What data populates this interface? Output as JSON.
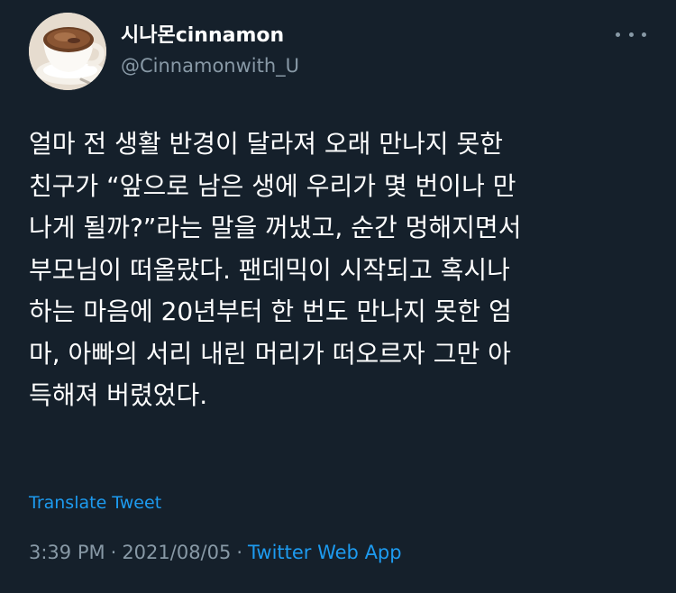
{
  "user": {
    "display_name": "시나몬cinnamon",
    "handle": "@Cinnamonwith_U"
  },
  "tweet": {
    "lines": [
      "얼마 전 생활 반경이 달라져 오래 만나지 못한",
      "친구가 “앞으로 남은 생에 우리가 몇 번이나 만",
      "나게 될까?”라는 말을 꺼냈고, 순간 멍해지면서",
      "부모님이 떠올랐다. 팬데믹이 시작되고 혹시나",
      "하는 마음에 20년부터 한 번도 만나지 못한 엄",
      "마, 아빠의 서리 내린 머리가 떠오르자 그만 아",
      "득해져 버렸었다."
    ],
    "translate_label": "Translate Tweet",
    "time": "3:39 PM",
    "date": "2021/08/05",
    "separator": "·",
    "source": "Twitter Web App"
  },
  "icons": {
    "avatar": "coffee-cup-avatar",
    "more": "more-options-icon"
  },
  "colors": {
    "background": "#15202b",
    "text": "#ffffff",
    "muted": "#8899a6",
    "link": "#1d9bf0"
  }
}
